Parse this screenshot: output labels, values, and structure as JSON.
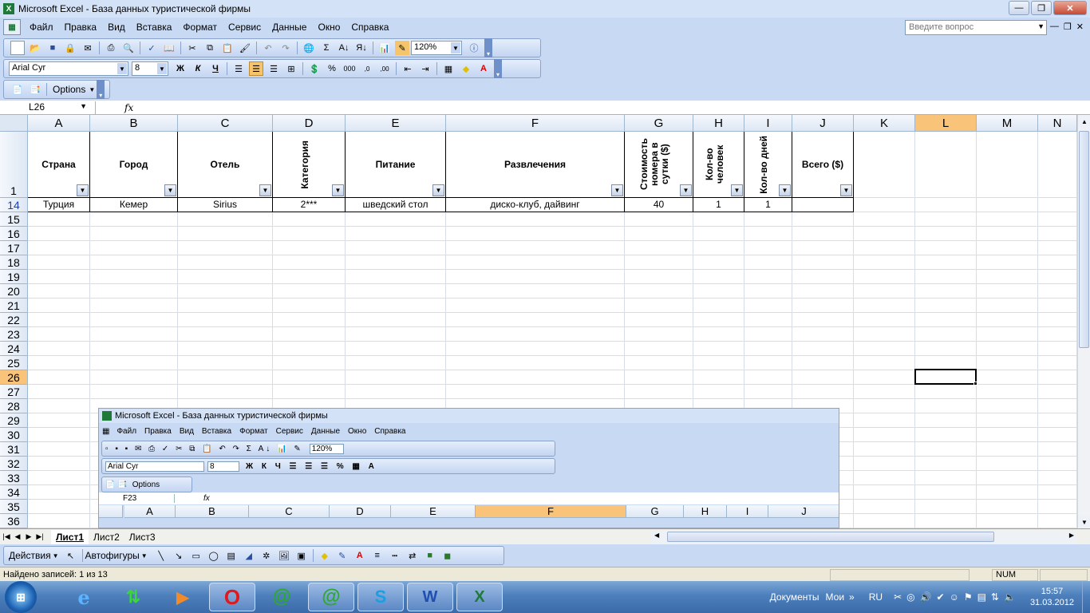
{
  "window": {
    "title": "Microsoft Excel - База данных туристической фирмы",
    "app_icon": "X"
  },
  "menu": {
    "items": [
      "Файл",
      "Правка",
      "Вид",
      "Вставка",
      "Формат",
      "Сервис",
      "Данные",
      "Окно",
      "Справка"
    ],
    "help_placeholder": "Введите вопрос"
  },
  "toolbar": {
    "zoom": "120%",
    "font_name": "Arial Cyr",
    "font_size": "8",
    "bold": "Ж",
    "italic": "К",
    "underline": "Ч",
    "percent": "%",
    "thousands": "000",
    "options_label": "Options"
  },
  "formula_bar": {
    "name_box": "L26",
    "fx": "fx",
    "content": ""
  },
  "sheet": {
    "columns": [
      "A",
      "B",
      "C",
      "D",
      "E",
      "F",
      "G",
      "H",
      "I",
      "J",
      "K",
      "L",
      "M",
      "N"
    ],
    "selected_column": "L",
    "header_row_number": "1",
    "headers": [
      {
        "text": "Страна",
        "vertical": false
      },
      {
        "text": "Город",
        "vertical": false
      },
      {
        "text": "Отель",
        "vertical": false
      },
      {
        "text": "Категория",
        "vertical": true
      },
      {
        "text": "Питание",
        "vertical": false
      },
      {
        "text": "Развлечения",
        "vertical": false
      },
      {
        "text": "Стоимость номера в сутки ($)",
        "vertical": true
      },
      {
        "text": "Кол-во человек",
        "vertical": true
      },
      {
        "text": "Кол-во дней",
        "vertical": true
      },
      {
        "text": "Всего ($)",
        "vertical": false
      }
    ],
    "data_row": {
      "row_number": "14",
      "cells": [
        "Турция",
        "Кемер",
        "Sirius",
        "2***",
        "шведский стол",
        "диско-клуб, дайвинг",
        "40",
        "1",
        "1",
        ""
      ]
    },
    "row_numbers": [
      "15",
      "16",
      "17",
      "18",
      "19",
      "20",
      "21",
      "22",
      "23",
      "24",
      "25",
      "26",
      "27",
      "28",
      "29",
      "30",
      "31",
      "32",
      "33",
      "34",
      "35",
      "36"
    ],
    "selected_row": "26",
    "tabs": [
      "Лист1",
      "Лист2",
      "Лист3"
    ],
    "active_tab": "Лист1"
  },
  "drawing": {
    "actions_label": "Действия",
    "autoshapes_label": "Автофигуры"
  },
  "status": {
    "text": "Найдено записей: 1 из 13",
    "num": "NUM"
  },
  "nested": {
    "title": "Microsoft Excel - База данных туристической фирмы",
    "menu": [
      "Файл",
      "Правка",
      "Вид",
      "Вставка",
      "Формат",
      "Сервис",
      "Данные",
      "Окно",
      "Справка"
    ],
    "zoom": "120%",
    "font_name": "Arial Cyr",
    "font_size": "8",
    "options_label": "Options",
    "name_box": "F23",
    "columns": [
      "A",
      "B",
      "C",
      "D",
      "E",
      "F",
      "G",
      "H",
      "I",
      "J"
    ],
    "selected_column": "F"
  },
  "taskbar": {
    "apps": [
      "ie-icon",
      "transfer-icon",
      "media-player-icon",
      "opera-icon",
      "mail-agent-icon",
      "mail-agent-2-icon",
      "skype-icon",
      "word-icon",
      "excel-icon"
    ],
    "documents": "Документы",
    "my": "Мои",
    "lang": "RU",
    "time": "15:57",
    "date": "31.03.2012"
  },
  "colors": {
    "chrome": "#c8d9f4",
    "selected_header": "#f9c47a",
    "taskbar": "#4c7fbc"
  }
}
